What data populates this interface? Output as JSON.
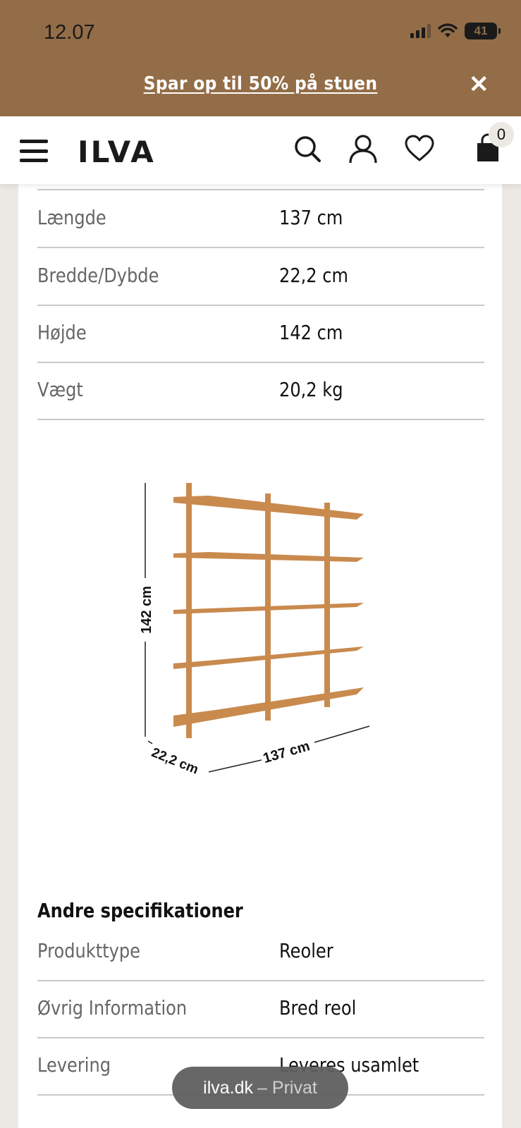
{
  "status_bar": {
    "time": "12.07",
    "battery": "41"
  },
  "promo": {
    "text": "Spar op til 50% på stuen",
    "close_symbol": "✕"
  },
  "header": {
    "logo": "ILVA",
    "cart_count": "0"
  },
  "dimensions": [
    {
      "label": "Længde",
      "value": "137 cm"
    },
    {
      "label": "Bredde/Dybde",
      "value": "22,2 cm"
    },
    {
      "label": "Højde",
      "value": "142 cm"
    },
    {
      "label": "Vægt",
      "value": "20,2 kg"
    }
  ],
  "diagram": {
    "height_label": "142 cm",
    "depth_label": "22,2 cm",
    "length_label": "137 cm"
  },
  "other_specs": {
    "title": "Andre specifikationer",
    "rows": [
      {
        "label": "Produkttype",
        "value": "Reoler"
      },
      {
        "label": "Øvrig Information",
        "value": "Bred reol"
      },
      {
        "label": "Levering",
        "value": "Leveres usamlet"
      }
    ]
  },
  "browser": {
    "domain": "ilva.dk",
    "mode": "– Privat"
  },
  "colors": {
    "banner": "#936d47",
    "background": "#ece8e3",
    "wood": "#c98a4e"
  }
}
